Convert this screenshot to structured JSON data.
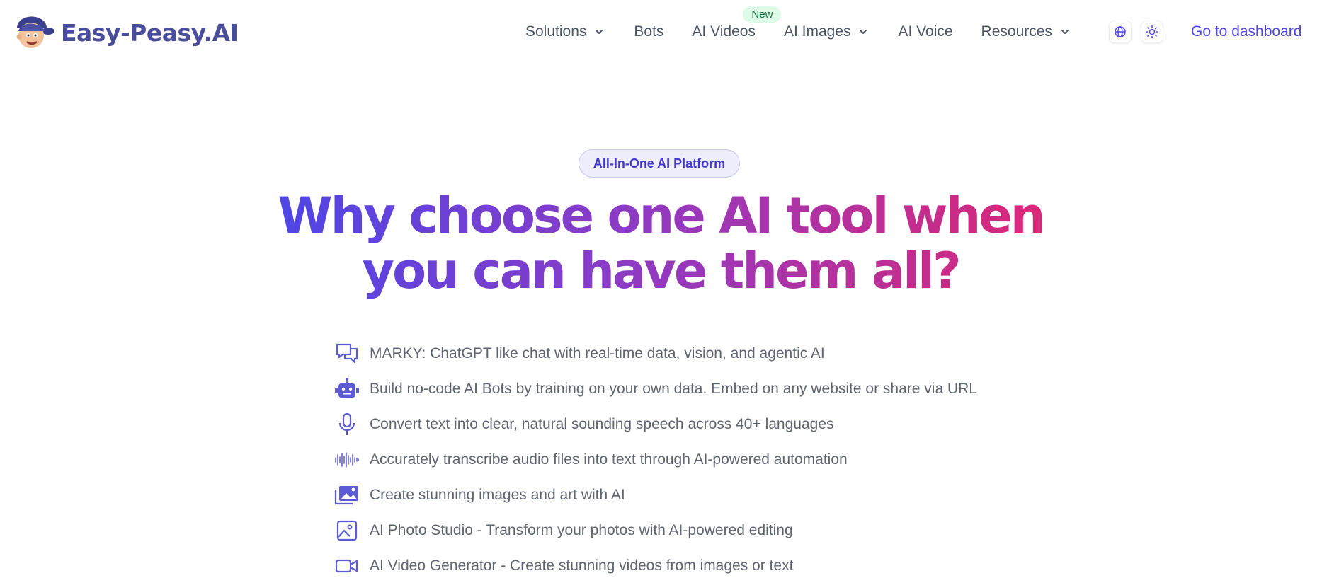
{
  "brand": {
    "name": "Easy-Peasy.AI"
  },
  "nav": {
    "items": [
      {
        "label": "Solutions",
        "dropdown": true
      },
      {
        "label": "Bots",
        "dropdown": false
      },
      {
        "label": "AI Videos",
        "dropdown": false,
        "badge": "New"
      },
      {
        "label": "AI Images",
        "dropdown": true
      },
      {
        "label": "AI Voice",
        "dropdown": false
      },
      {
        "label": "Resources",
        "dropdown": true
      }
    ],
    "language_icon": "globe-icon",
    "theme_icon": "sun-icon",
    "dashboard_label": "Go to dashboard"
  },
  "hero": {
    "pill": "All-In-One AI Platform",
    "headline_line1": "Why choose one AI tool when",
    "headline_line2": "you can have them all?",
    "features": [
      {
        "icon": "chat-bubbles-icon",
        "text": "MARKY: ChatGPT like chat with real-time data, vision, and agentic AI"
      },
      {
        "icon": "robot-icon",
        "text": "Build no-code AI Bots by training on your own data. Embed on any website or share via URL"
      },
      {
        "icon": "microphone-icon",
        "text": "Convert text into clear, natural sounding speech across 40+ languages"
      },
      {
        "icon": "waveform-icon",
        "text": "Accurately transcribe audio files into text through AI-powered automation"
      },
      {
        "icon": "image-stack-icon",
        "text": "Create stunning images and art with AI"
      },
      {
        "icon": "photo-icon",
        "text": "AI Photo Studio - Transform your photos with AI-powered editing"
      },
      {
        "icon": "video-camera-icon",
        "text": "AI Video Generator - Create stunning videos from images or text"
      }
    ]
  },
  "colors": {
    "accent": "#4f46e5",
    "gradient_start": "#4f46e5",
    "gradient_end": "#db2777",
    "badge_green_bg": "#dcfce7",
    "logo_text": "#4a4d9c"
  }
}
